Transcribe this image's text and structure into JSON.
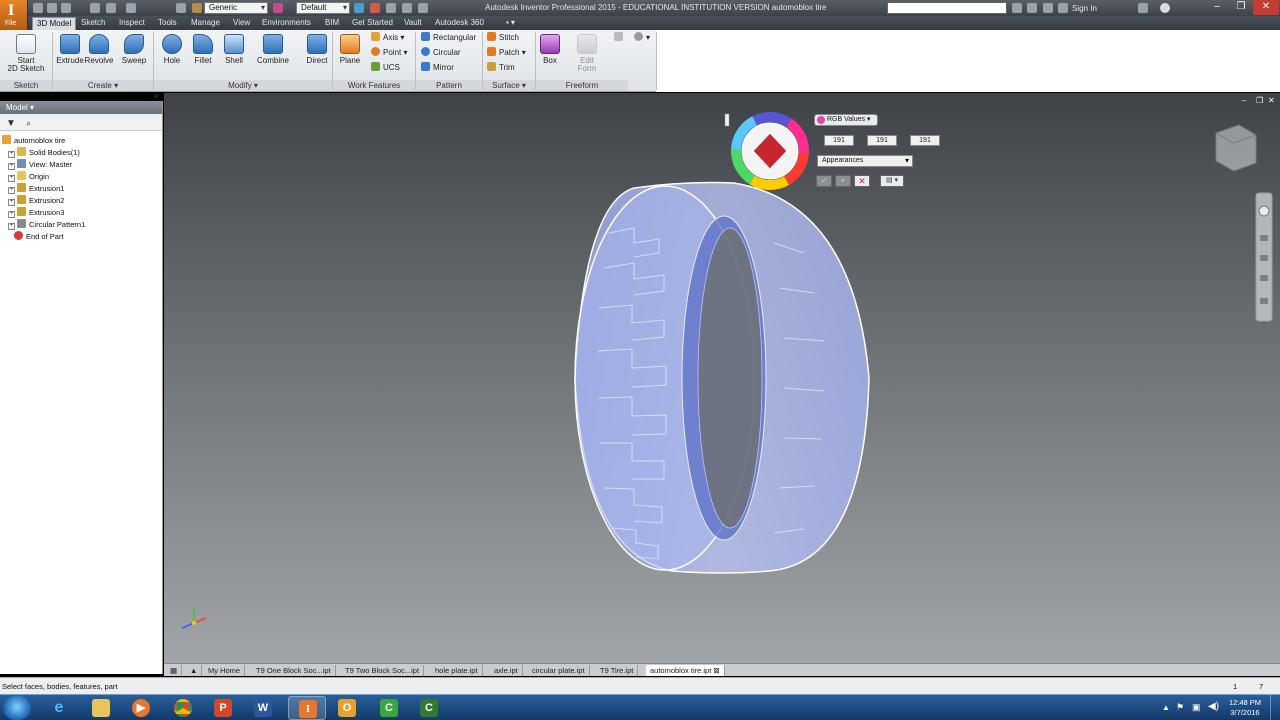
{
  "app": {
    "button_label": "File",
    "title": "Autodesk Inventor Professional 2015 - EDUCATIONAL INSTITUTION VERSION    automoblox tire",
    "material_combo": "Generic",
    "appearance_combo": "Default",
    "sign_in": "Sign In"
  },
  "tabs": [
    "3D Model",
    "Sketch",
    "Inspect",
    "Tools",
    "Manage",
    "View",
    "Environments",
    "BIM",
    "Get Started",
    "Vault",
    "Autodesk 360"
  ],
  "ribbon": {
    "start_sketch": "Start\n2D Sketch",
    "extrude": "Extrude",
    "revolve": "Revolve",
    "sweep": "Sweep",
    "hole": "Hole",
    "fillet": "Fillet",
    "shell": "Shell",
    "combine": "Combine",
    "direct": "Direct",
    "plane": "Plane",
    "axis": "Axis",
    "point": "Point",
    "ucs": "UCS",
    "rectangular": "Rectangular",
    "circular": "Circular",
    "mirror": "Mirror",
    "stitch": "Stitch",
    "patch": "Patch",
    "trim": "Trim",
    "box": "Box",
    "edit_form": "Edit\nForm",
    "panels": {
      "sketch": "Sketch",
      "create": "Create",
      "modify": "Modify",
      "work_features": "Work Features",
      "pattern": "Pattern",
      "surface": "Surface",
      "freeform": "Freeform"
    }
  },
  "browser": {
    "title": "Model",
    "items": [
      {
        "label": "automoblox tire",
        "color": "#e8a23a"
      },
      {
        "label": "Solid Bodies(1)",
        "color": "#d9b84a"
      },
      {
        "label": "View: Master",
        "color": "#6f8fb8"
      },
      {
        "label": "Origin",
        "color": "#e8c45a"
      },
      {
        "label": "Extrusion1",
        "color": "#c9a13a"
      },
      {
        "label": "Extrusion2",
        "color": "#c9a13a"
      },
      {
        "label": "Extrusion3",
        "color": "#c9a13a"
      },
      {
        "label": "Circular Pattern1",
        "color": "#8a8a8a"
      },
      {
        "label": "End of Part",
        "color": "#d33a3a"
      }
    ]
  },
  "color_picker": {
    "mode": "RGB Values",
    "r": "191",
    "g": "191",
    "b": "191",
    "target": "Appearances"
  },
  "doc_tabs": [
    "My Home",
    "T9 One Block Soc...ipt",
    "T9 Two Block Soc...ipt",
    "hole plate.ipt",
    "axle.ipt",
    "circular plate.ipt",
    "T9 Tire.ipt",
    "automoblox tire.ipt"
  ],
  "status": {
    "text": "Select faces, bodies, features, part",
    "count1": "1",
    "count2": "7"
  },
  "clock": {
    "time": "12:48 PM",
    "date": "3/7/2016"
  },
  "colors": {
    "tire_fill": "#a9b6f0",
    "tire_edge": "#ffffff",
    "accent": "#2f6fb8"
  }
}
